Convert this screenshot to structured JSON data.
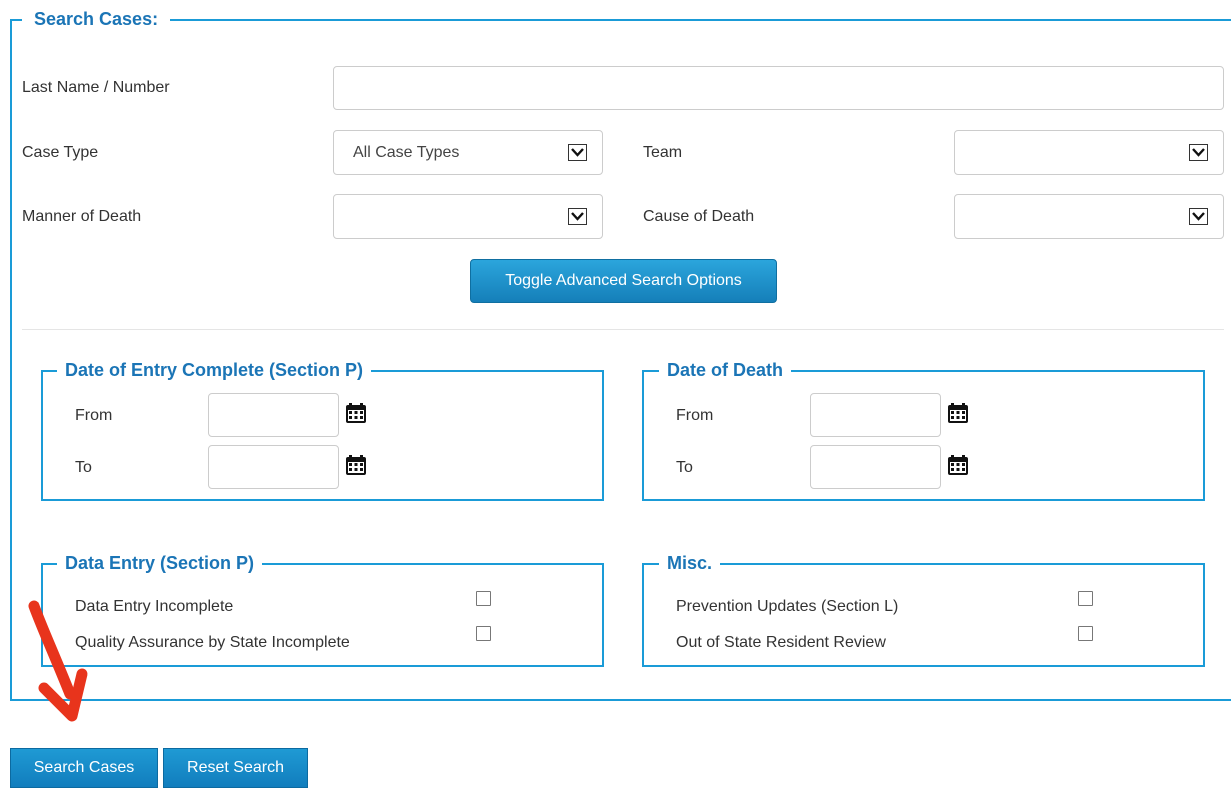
{
  "search_cases": {
    "legend": "Search Cases:",
    "last_name_label": "Last Name / Number",
    "last_name_value": "",
    "case_type_label": "Case Type",
    "case_type_value": "All Case Types",
    "team_label": "Team",
    "team_value": "",
    "manner_label": "Manner of Death",
    "manner_value": "",
    "cause_label": "Cause of Death",
    "cause_value": "",
    "toggle_label": "Toggle Advanced Search Options"
  },
  "date_entry": {
    "legend": "Date of Entry Complete (Section P)",
    "from_label": "From",
    "to_label": "To",
    "from_value": "",
    "to_value": ""
  },
  "date_death": {
    "legend": "Date of Death",
    "from_label": "From",
    "to_label": "To",
    "from_value": "",
    "to_value": ""
  },
  "data_entry": {
    "legend": "Data Entry (Section P)",
    "items": [
      {
        "label": "Data Entry Incomplete",
        "checked": false
      },
      {
        "label": "Quality Assurance by State Incomplete",
        "checked": false
      }
    ]
  },
  "misc": {
    "legend": "Misc.",
    "items": [
      {
        "label": "Prevention Updates (Section L)",
        "checked": false
      },
      {
        "label": "Out of State Resident Review",
        "checked": false
      }
    ]
  },
  "buttons": {
    "search": "Search Cases",
    "reset": "Reset Search"
  },
  "colors": {
    "accent": "#1a9bd7",
    "legend_text": "#1b75b6",
    "annotation_arrow": "#e8341c"
  },
  "icons": {
    "calendar": "calendar-icon",
    "dropdown": "chevron-down-icon",
    "annotation": "red-arrow-icon"
  }
}
